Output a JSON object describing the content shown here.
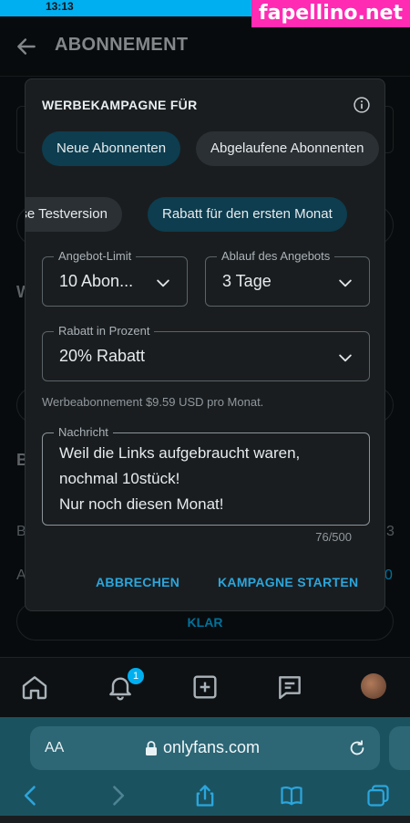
{
  "status_bar": {
    "time": "13:13"
  },
  "watermark": "fapellino.net",
  "page": {
    "title": "ABONNEMENT",
    "klar_label": "KLAR"
  },
  "modal": {
    "title": "WERBEKAMPAGNE FÜR",
    "audience_chips": [
      {
        "label": "Neue Abonnenten",
        "selected": true
      },
      {
        "label": "Abgelaufene Abonnenten",
        "selected": false
      }
    ],
    "type_chips": [
      {
        "label": "ose Testversion",
        "selected": false
      },
      {
        "label": "Rabatt für den ersten Monat",
        "selected": true
      }
    ],
    "offer_limit": {
      "label": "Angebot-Limit",
      "value": "10 Abon..."
    },
    "offer_expiry": {
      "label": "Ablauf des Angebots",
      "value": "3 Tage"
    },
    "discount": {
      "label": "Rabatt in Prozent",
      "value": "20% Rabatt"
    },
    "hint": "Werbeabonnement $9.59 USD pro Monat.",
    "message": {
      "label": "Nachricht",
      "lines": [
        "Weil die Links aufgebraucht waren,",
        "nochmal 10stück!",
        "Nur noch diesen Monat!"
      ],
      "counter": "76/500"
    },
    "cancel_label": "ABBRECHEN",
    "start_label": "KAMPAGNE STARTEN"
  },
  "nav": {
    "notification_count": "1"
  },
  "browser": {
    "aa_label": "AA",
    "url": "onlyfans.com"
  },
  "colors": {
    "accent": "#00aff0",
    "chip_active": "#0d3d4f",
    "modal_bg": "#1a1d1f",
    "browser_bg": "#1b5260"
  }
}
